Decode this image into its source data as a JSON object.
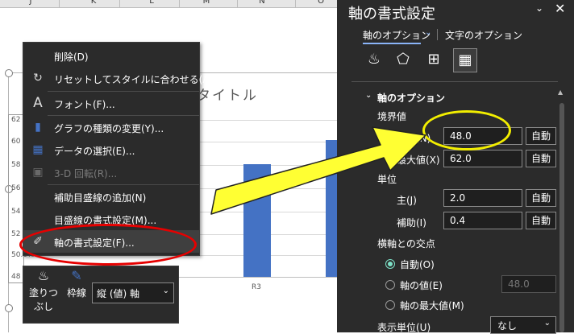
{
  "columns": [
    "J",
    "K",
    "L",
    "M",
    "N",
    "O"
  ],
  "chart": {
    "title_fragment": "タイトル",
    "y_ticks": [
      "62",
      "60",
      "58",
      "56",
      "54",
      "52",
      "50.0%",
      "48"
    ],
    "x_label": "R3"
  },
  "context_menu": {
    "items": [
      {
        "label": "削除(D)",
        "icon": "delete-icon",
        "enabled": true
      },
      {
        "label": "リセットしてスタイルに合わせる(A)",
        "icon": "reset-style-icon",
        "enabled": true
      },
      {
        "label": "フォント(F)...",
        "icon": "font-icon",
        "enabled": true
      },
      {
        "label": "グラフの種類の変更(Y)...",
        "icon": "chart-type-icon",
        "enabled": true
      },
      {
        "label": "データの選択(E)...",
        "icon": "select-data-icon",
        "enabled": true
      },
      {
        "label": "3-D 回転(R)...",
        "icon": "rotation-3d-icon",
        "enabled": false
      },
      {
        "label": "補助目盛線の追加(N)",
        "icon": "",
        "enabled": true
      },
      {
        "label": "目盛線の書式設定(M)...",
        "icon": "",
        "enabled": true
      },
      {
        "label": "軸の書式設定(F)...",
        "icon": "format-axis-icon",
        "enabled": true
      }
    ]
  },
  "mini_toolbar": {
    "fill_label": "塗りつぶし",
    "fill_line1": "塗りつ",
    "fill_line2": "ぶし",
    "outline_label": "枠線",
    "element_select": "縦 (値) 軸"
  },
  "pane": {
    "title": "軸の書式設定",
    "tab_axis_options": "軸のオプション",
    "tab_text_options": "文字のオプション",
    "section_title": "軸のオプション",
    "bounds_label": "境界値",
    "min_label": "小値(N)",
    "min_value": "48.0",
    "max_label": "最大値(X)",
    "max_value": "62.0",
    "units_label": "単位",
    "major_label": "主(J)",
    "major_value": "2.0",
    "minor_label": "補助(I)",
    "minor_value": "0.4",
    "auto_label": "自動",
    "crosses_label": "横軸との交点",
    "cross_auto": "自動(O)",
    "cross_value": "軸の値(E)",
    "cross_value_input": "48.0",
    "cross_max": "軸の最大値(M)",
    "display_units_label": "表示単位(U)",
    "display_units_value": "なし"
  },
  "colors": {
    "bar": "#4472c4",
    "annotation_red": "#e60000",
    "annotation_yellow": "#f2ee00",
    "pane_bg": "#2b2b2b"
  }
}
